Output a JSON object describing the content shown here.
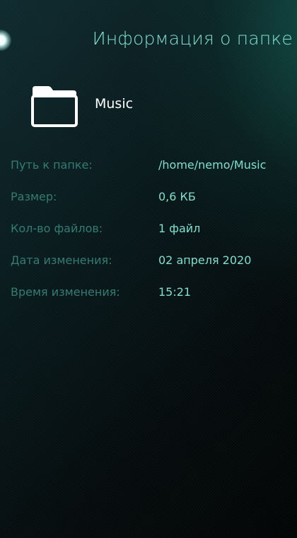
{
  "header": {
    "title": "Информация о папке"
  },
  "folder": {
    "name": "Music",
    "icon": "folder-icon"
  },
  "properties": [
    {
      "label": "Путь к папке:",
      "value": "/home/nemo/Music"
    },
    {
      "label": "Размер:",
      "value": "0,6 КБ"
    },
    {
      "label": "Кол-во файлов:",
      "value": "1 файл"
    },
    {
      "label": "Дата изменения:",
      "value": "02 апреля 2020"
    },
    {
      "label": "Время изменения:",
      "value": "15:21"
    }
  ],
  "colors": {
    "accent": "#7ee0d0",
    "secondary": "#347c73",
    "primary_text": "#ffffff",
    "background": "#061416"
  }
}
